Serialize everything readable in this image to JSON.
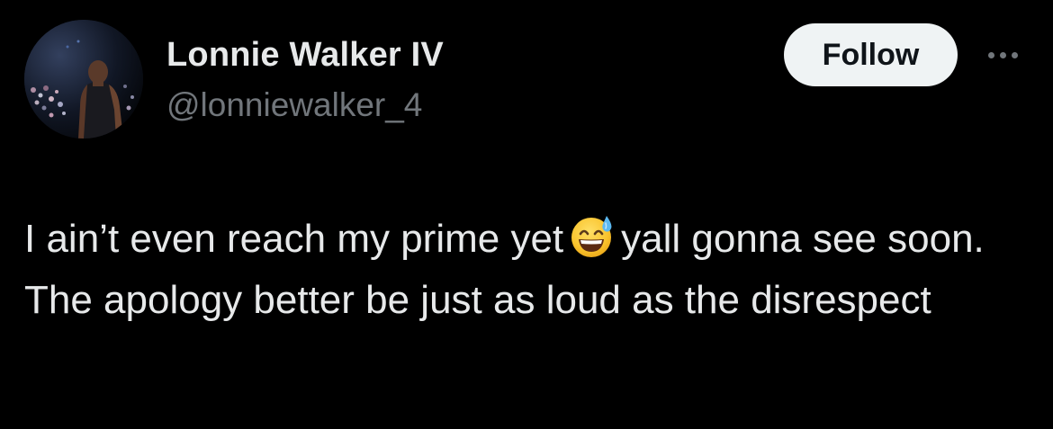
{
  "tweet": {
    "author": {
      "display_name": "Lonnie Walker IV",
      "handle": "@lonniewalker_4",
      "avatar_icon": "profile-photo-avatar"
    },
    "follow_label": "Follow",
    "more_icon": "more-horizontal-icon",
    "text_part1": "I ain’t even reach my prime yet",
    "emoji_icon": "grinning-face-with-sweat-emoji",
    "text_part2": "yall gonna see soon. The apology better be just as loud as the disrespect"
  },
  "colors": {
    "background": "#000000",
    "primary_text": "#e7e9ea",
    "secondary_text": "#71767b",
    "follow_button_bg": "#eff3f4",
    "follow_button_text": "#0f1419"
  }
}
